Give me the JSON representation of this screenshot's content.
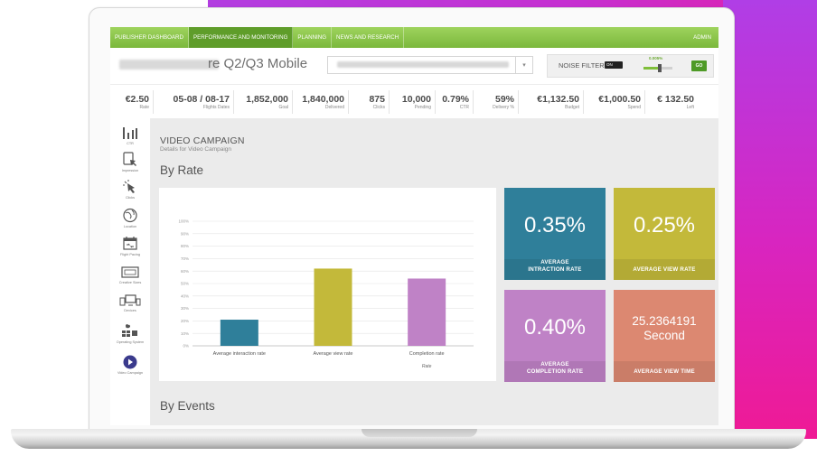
{
  "colors": {
    "nav_green": "#8cc84b",
    "nav_active": "#5f9d2a",
    "tile_blue": "#2f7f9a",
    "tile_olive": "#c3b93a",
    "tile_purple": "#bf82c6",
    "tile_salmon": "#dc8871",
    "bar_blue": "#2f7f9a",
    "bar_olive": "#c3b93a",
    "bar_purple": "#bf82c6",
    "background_gradient": [
      "#b23de0",
      "#ef1a95"
    ]
  },
  "nav": {
    "items": [
      {
        "label": "PUBLISHER DASHBOARD",
        "active": false
      },
      {
        "label": "PERFORMANCE AND MONITORING",
        "active": true
      },
      {
        "label": "PLANNING",
        "active": false
      },
      {
        "label": "NEWS AND RESEARCH",
        "active": false
      }
    ],
    "admin": "ADMIN"
  },
  "header": {
    "campaign_title": "re Q2/Q3 Mobile",
    "noise_filter_label": "NOISE FILTER",
    "noise_toggle": "ON",
    "noise_slider_label": "0.005%",
    "go_label": "GO",
    "select_arrow": "▾"
  },
  "stats": [
    {
      "value": "€2.50",
      "label": "Rate"
    },
    {
      "value": "05-08 / 08-17",
      "label": "Flights Dates"
    },
    {
      "value": "1,852,000",
      "label": "Goal"
    },
    {
      "value": "1,840,000",
      "label": "Delivered"
    },
    {
      "value": "875",
      "label": "Clicks"
    },
    {
      "value": "10,000",
      "label": "Pending"
    },
    {
      "value": "0.79%",
      "label": "CTR"
    },
    {
      "value": "59%",
      "label": "Delivery %"
    },
    {
      "value": "€1,132.50",
      "label": "Budget"
    },
    {
      "value": "€1,000.50",
      "label": "Spend"
    },
    {
      "value": "€ 132.50",
      "label": "Left"
    }
  ],
  "sidebar": {
    "items": [
      {
        "label": "CTR",
        "icon": "bar-chart-icon"
      },
      {
        "label": "Impression",
        "icon": "impression-icon"
      },
      {
        "label": "Clicks",
        "icon": "cursor-click-icon"
      },
      {
        "label": "Location",
        "icon": "globe-icon"
      },
      {
        "label": "Flight Pacing",
        "icon": "calendar-icon"
      },
      {
        "label": "Creative Sizes",
        "icon": "creative-size-icon"
      },
      {
        "label": "Devices",
        "icon": "devices-icon"
      },
      {
        "label": "Operating System",
        "icon": "os-icon"
      },
      {
        "label": "Video Campaign",
        "icon": "play-icon"
      }
    ]
  },
  "main": {
    "section_title": "VIDEO CAMPAIGN",
    "section_subtitle": "Details for Video Campaign",
    "by_rate": "By Rate",
    "by_events": "By Events"
  },
  "tiles": [
    {
      "value": "0.35%",
      "label_line1": "AVERAGE",
      "label_line2": "INTRACTION RATE"
    },
    {
      "value": "0.25%",
      "label_line1": "",
      "label_line2": "AVERAGE VIEW RATE"
    },
    {
      "value": "0.40%",
      "label_line1": "AVERAGE",
      "label_line2": "COMPLETION RATE"
    },
    {
      "value": "25.2364191",
      "value_line2": "Second",
      "label_line1": "",
      "label_line2": "AVERAGE VIEW TIME"
    }
  ],
  "chart_data": {
    "type": "bar",
    "categories": [
      "Average interaction rate",
      "Average view rate",
      "Completion rate"
    ],
    "values": [
      21,
      62,
      54
    ],
    "xlabel": "Rate",
    "ylabel": "",
    "ylim": [
      0,
      100
    ],
    "yticks": [
      "0%",
      "10%",
      "20%",
      "30%",
      "40%",
      "50%",
      "60%",
      "70%",
      "80%",
      "90%",
      "100%"
    ],
    "grid": true,
    "colors": [
      "#2f7f9a",
      "#c3b93a",
      "#bf82c6"
    ]
  }
}
